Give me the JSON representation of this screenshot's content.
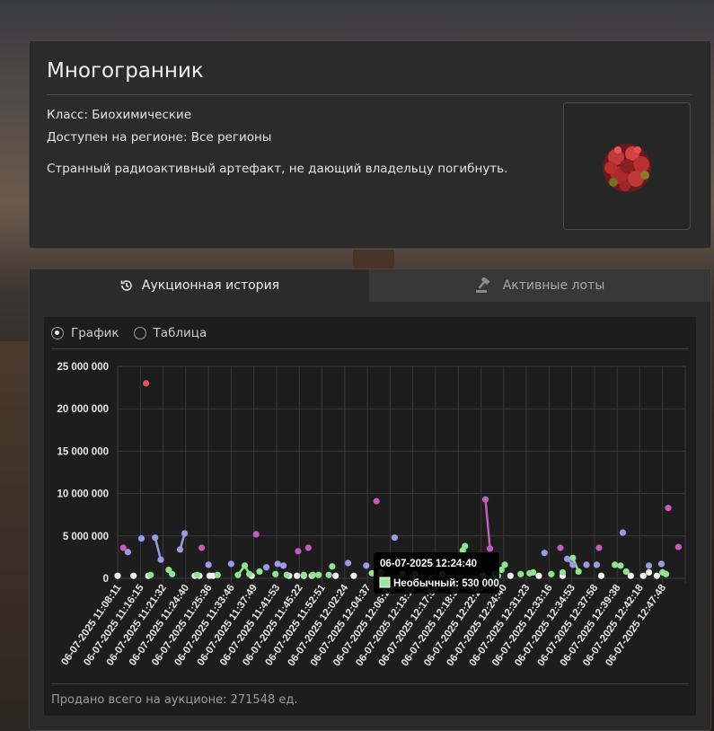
{
  "item": {
    "name": "Многогранник",
    "class_line": "Класс: Биохимические",
    "region_line": "Доступен на регионе: Все регионы",
    "description": "Странный радиоактивный артефакт, не дающий владельцу погибнуть."
  },
  "tabs": {
    "history": {
      "label": "Аукционная история",
      "icon": "history-icon",
      "active": true
    },
    "lots": {
      "label": "Активные лоты",
      "icon": "gavel-icon",
      "active": false
    }
  },
  "view": {
    "graph_label": "График",
    "table_label": "Таблица",
    "selected": "graph"
  },
  "footer": {
    "sold_total": "Продано всего на аукционе: 271548 ед."
  },
  "tooltip": {
    "time": "06-07-2025 12:24:40",
    "line": "Необычный: 530 000",
    "color": "#9ee89e"
  },
  "chart_data": {
    "type": "scatter",
    "ylim": [
      0,
      25000000
    ],
    "yticks": [
      {
        "value": 0,
        "label": "0"
      },
      {
        "value": 5000000,
        "label": "5 000 000"
      },
      {
        "value": 10000000,
        "label": "10 000 000"
      },
      {
        "value": 15000000,
        "label": "15 000 000"
      },
      {
        "value": 20000000,
        "label": "20 000 000"
      },
      {
        "value": 25000000,
        "label": "25 000 000"
      }
    ],
    "x_labels": [
      "06-07-2025 11:08:11",
      "06-07-2025 11:16:15",
      "06-07-2025 11:21:32",
      "06-07-2025 11:24:40",
      "06-07-2025 11:25:36",
      "06-07-2025 11:33:46",
      "06-07-2025 11:37:49",
      "06-07-2025 11:41:53",
      "06-07-2025 11:45:22",
      "06-07-2025 11:52:51",
      "06-07-2025 12:02:24",
      "06-07-2025 12:04:37",
      "06-07-2025 12:06:28",
      "06-07-2025 12:13:14",
      "06-07-2025 12:17:54",
      "06-07-2025 12:18:37",
      "06-07-2025 12:22:26",
      "06-07-2025 12:24:40",
      "06-07-2025 12:31:23",
      "06-07-2025 12:33:16",
      "06-07-2025 12:34:53",
      "06-07-2025 12:37:58",
      "06-07-2025 12:39:38",
      "06-07-2025 12:42:18",
      "06-07-2025 12:47:48"
    ],
    "series": [
      {
        "key": "white",
        "color": "#f2f2f2",
        "points": [
          [
            0,
            300000
          ],
          [
            0.7,
            300000
          ],
          [
            1.35,
            300000
          ],
          [
            3.4,
            300000
          ],
          [
            3.6,
            300000
          ],
          [
            4.05,
            300000
          ],
          [
            4.2,
            300000
          ],
          [
            5.9,
            300000
          ],
          [
            7.55,
            300000
          ],
          [
            7.9,
            300000
          ],
          [
            8.2,
            300000
          ],
          [
            8.55,
            300000
          ],
          [
            9.6,
            300000
          ],
          [
            10.4,
            300000
          ],
          [
            16.1,
            300000
          ],
          [
            17.3,
            300000
          ],
          [
            18.55,
            300000
          ],
          [
            19.6,
            300000
          ],
          [
            21.3,
            300000
          ],
          [
            22.6,
            300000
          ],
          [
            23.15,
            300000
          ],
          [
            23.4,
            700000
          ],
          [
            23.75,
            300000
          ]
        ]
      },
      {
        "key": "green",
        "color": "#8fe58f",
        "points": [
          [
            1.45,
            400000
          ],
          [
            2.25,
            1000000
          ],
          [
            2.4,
            500000
          ],
          [
            3.5,
            400000
          ],
          [
            4.4,
            400000
          ],
          [
            5.3,
            400000
          ],
          [
            5.6,
            1500000
          ],
          [
            5.8,
            500000
          ],
          [
            6.25,
            800000
          ],
          [
            6.95,
            500000
          ],
          [
            7.45,
            400000
          ],
          [
            8.2,
            400000
          ],
          [
            8.6,
            400000
          ],
          [
            8.85,
            400000
          ],
          [
            9.3,
            400000
          ],
          [
            9.45,
            1400000
          ],
          [
            11.2,
            600000
          ],
          [
            11.6,
            700000
          ],
          [
            12.55,
            500000
          ],
          [
            13.1,
            500000
          ],
          [
            14.3,
            500000
          ],
          [
            15.2,
            3300000
          ],
          [
            15.3,
            3800000
          ],
          [
            16.6,
            500000
          ],
          [
            16.75,
            300000
          ],
          [
            16.9,
            1000000
          ],
          [
            17.05,
            1600000
          ],
          [
            17.75,
            500000
          ],
          [
            18.15,
            600000
          ],
          [
            18.3,
            700000
          ],
          [
            19.1,
            500000
          ],
          [
            19.6,
            700000
          ],
          [
            20.05,
            2400000
          ],
          [
            20.3,
            800000
          ],
          [
            21.9,
            1600000
          ],
          [
            22.15,
            1500000
          ],
          [
            22.4,
            800000
          ],
          [
            24.0,
            700000
          ],
          [
            24.15,
            500000
          ]
        ]
      },
      {
        "key": "blue",
        "color": "#9a9ae6",
        "points": [
          [
            0.45,
            3100000
          ],
          [
            1.05,
            4700000
          ],
          [
            1.65,
            4800000
          ],
          [
            1.9,
            2200000
          ],
          [
            2.75,
            3400000
          ],
          [
            2.95,
            5300000
          ],
          [
            4.0,
            1600000
          ],
          [
            5.0,
            1700000
          ],
          [
            6.55,
            1300000
          ],
          [
            7.05,
            1700000
          ],
          [
            7.3,
            1500000
          ],
          [
            10.15,
            1800000
          ],
          [
            10.95,
            1500000
          ],
          [
            12.2,
            4800000
          ],
          [
            18.8,
            3000000
          ],
          [
            19.8,
            2300000
          ],
          [
            20.05,
            1600000
          ],
          [
            20.65,
            1600000
          ],
          [
            21.1,
            1600000
          ],
          [
            22.25,
            5400000
          ],
          [
            23.4,
            1500000
          ],
          [
            23.95,
            1700000
          ]
        ]
      },
      {
        "key": "purple",
        "color": "#c45cbd",
        "points": [
          [
            0.25,
            3600000
          ],
          [
            3.7,
            3600000
          ],
          [
            6.1,
            5200000
          ],
          [
            7.95,
            3200000
          ],
          [
            8.4,
            3600000
          ],
          [
            11.4,
            9100000
          ],
          [
            16.2,
            9300000
          ],
          [
            16.4,
            3500000
          ],
          [
            19.5,
            3600000
          ],
          [
            21.2,
            3600000
          ],
          [
            24.25,
            8300000
          ],
          [
            24.7,
            3700000
          ]
        ]
      },
      {
        "key": "red",
        "color": "#e05555",
        "points": [
          [
            1.25,
            23000000
          ]
        ]
      }
    ],
    "lines": [
      {
        "color": "#9a9ae6",
        "points": [
          [
            1.65,
            4800000
          ],
          [
            1.9,
            2200000
          ]
        ]
      },
      {
        "color": "#9a9ae6",
        "points": [
          [
            2.75,
            3400000
          ],
          [
            2.95,
            5300000
          ]
        ]
      },
      {
        "color": "#c45cbd",
        "points": [
          [
            16.2,
            9300000
          ],
          [
            16.4,
            3500000
          ]
        ]
      },
      {
        "color": "#8fe58f",
        "points": [
          [
            5.3,
            400000
          ],
          [
            5.6,
            1500000
          ],
          [
            5.8,
            500000
          ]
        ]
      },
      {
        "color": "#8fe58f",
        "points": [
          [
            15.2,
            3300000
          ],
          [
            15.3,
            3800000
          ]
        ]
      },
      {
        "color": "#8fe58f",
        "points": [
          [
            16.9,
            1000000
          ],
          [
            17.05,
            1600000
          ]
        ]
      },
      {
        "color": "#8fe58f",
        "points": [
          [
            20.05,
            2400000
          ],
          [
            20.3,
            800000
          ]
        ]
      },
      {
        "color": "#9a9ae6",
        "points": [
          [
            19.8,
            2300000
          ],
          [
            20.05,
            1600000
          ]
        ]
      }
    ]
  }
}
